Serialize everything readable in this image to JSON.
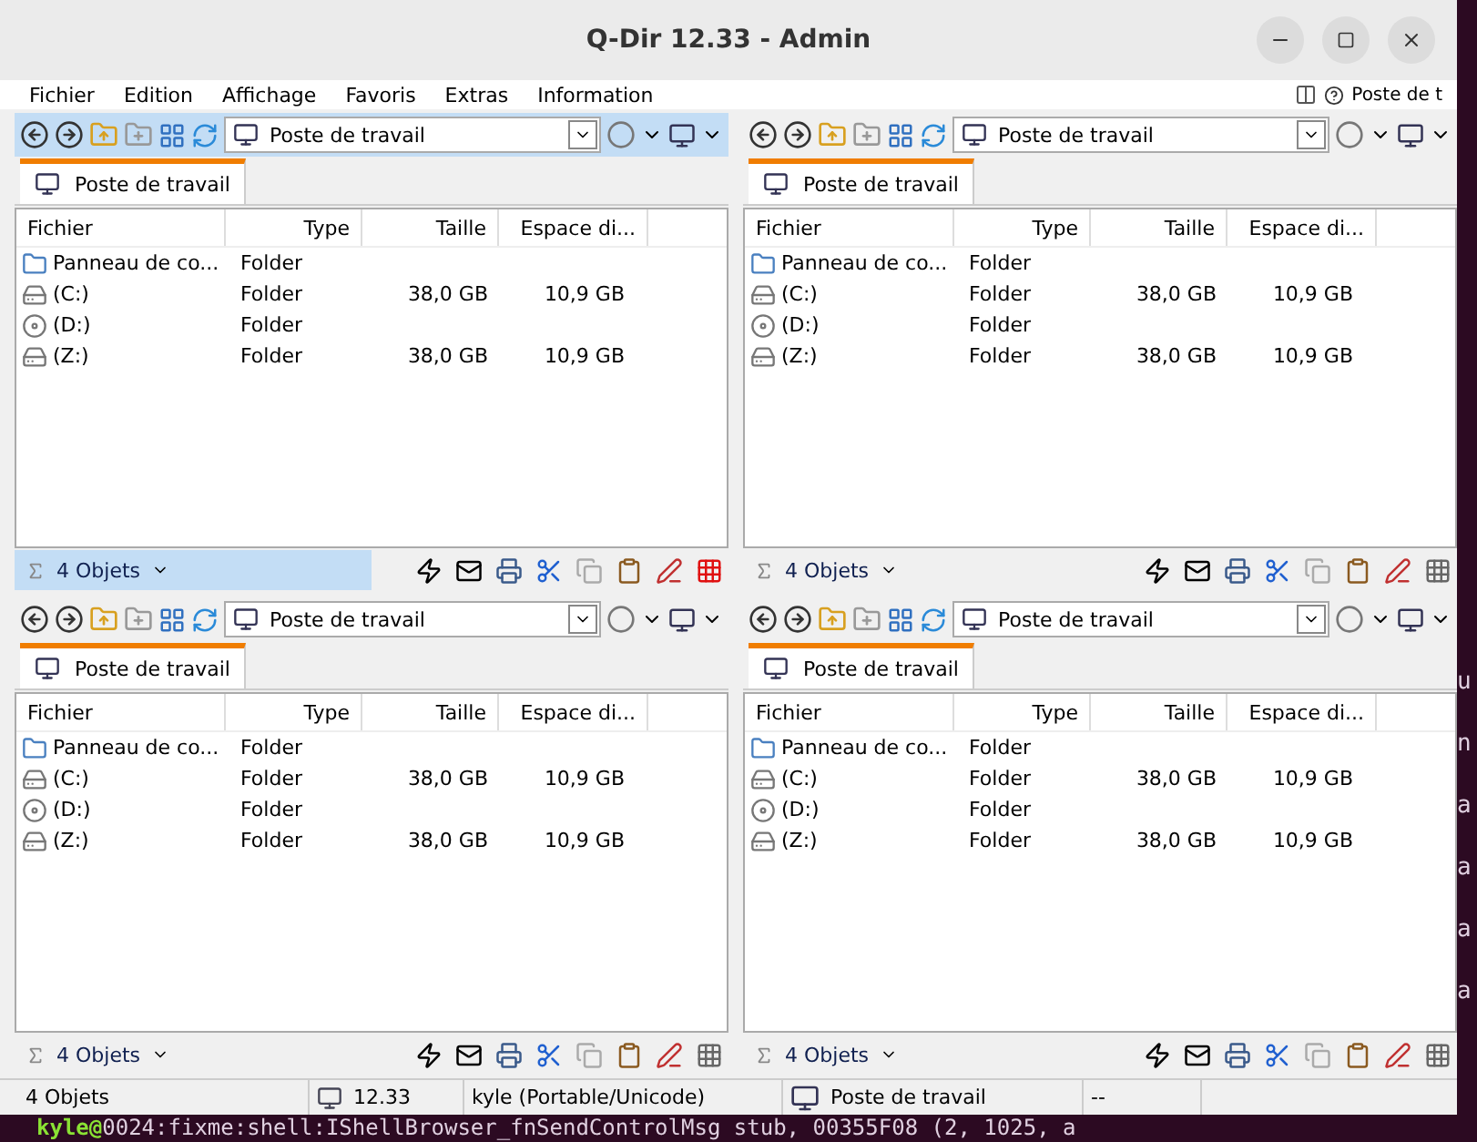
{
  "window": {
    "title": "Q-Dir 12.33 - Admin"
  },
  "menu": [
    "Fichier",
    "Edition",
    "Affichage",
    "Favoris",
    "Extras",
    "Information"
  ],
  "menu_right_label": "Poste de t",
  "panes": [
    {
      "active": true,
      "address": "Poste de travail",
      "tab": "Poste de travail",
      "columns": [
        "Fichier",
        "Type",
        "Taille",
        "Espace di..."
      ],
      "rows": [
        {
          "kind": "folder",
          "name": "Panneau de co...",
          "type": "Folder",
          "size": "",
          "free": ""
        },
        {
          "kind": "drive",
          "name": "(C:)",
          "type": "Folder",
          "size": "38,0 GB",
          "free": "10,9 GB"
        },
        {
          "kind": "cdrom",
          "name": "(D:)",
          "type": "Folder",
          "size": "",
          "free": ""
        },
        {
          "kind": "drive",
          "name": "(Z:)",
          "type": "Folder",
          "size": "38,0 GB",
          "free": "10,9 GB"
        }
      ],
      "status": "4 Objets"
    },
    {
      "active": false,
      "address": "Poste de travail",
      "tab": "Poste de travail",
      "columns": [
        "Fichier",
        "Type",
        "Taille",
        "Espace di..."
      ],
      "rows": [
        {
          "kind": "folder",
          "name": "Panneau de co...",
          "type": "Folder",
          "size": "",
          "free": ""
        },
        {
          "kind": "drive",
          "name": "(C:)",
          "type": "Folder",
          "size": "38,0 GB",
          "free": "10,9 GB"
        },
        {
          "kind": "cdrom",
          "name": "(D:)",
          "type": "Folder",
          "size": "",
          "free": ""
        },
        {
          "kind": "drive",
          "name": "(Z:)",
          "type": "Folder",
          "size": "38,0 GB",
          "free": "10,9 GB"
        }
      ],
      "status": "4 Objets"
    },
    {
      "active": false,
      "address": "Poste de travail",
      "tab": "Poste de travail",
      "columns": [
        "Fichier",
        "Type",
        "Taille",
        "Espace di..."
      ],
      "rows": [
        {
          "kind": "folder",
          "name": "Panneau de co...",
          "type": "Folder",
          "size": "",
          "free": ""
        },
        {
          "kind": "drive",
          "name": "(C:)",
          "type": "Folder",
          "size": "38,0 GB",
          "free": "10,9 GB"
        },
        {
          "kind": "cdrom",
          "name": "(D:)",
          "type": "Folder",
          "size": "",
          "free": ""
        },
        {
          "kind": "drive",
          "name": "(Z:)",
          "type": "Folder",
          "size": "38,0 GB",
          "free": "10,9 GB"
        }
      ],
      "status": "4 Objets"
    },
    {
      "active": false,
      "address": "Poste de travail",
      "tab": "Poste de travail",
      "columns": [
        "Fichier",
        "Type",
        "Taille",
        "Espace di..."
      ],
      "rows": [
        {
          "kind": "folder",
          "name": "Panneau de co...",
          "type": "Folder",
          "size": "",
          "free": ""
        },
        {
          "kind": "drive",
          "name": "(C:)",
          "type": "Folder",
          "size": "38,0 GB",
          "free": "10,9 GB"
        },
        {
          "kind": "cdrom",
          "name": "(D:)",
          "type": "Folder",
          "size": "",
          "free": ""
        },
        {
          "kind": "drive",
          "name": "(Z:)",
          "type": "Folder",
          "size": "38,0 GB",
          "free": "10,9 GB"
        }
      ],
      "status": "4 Objets"
    }
  ],
  "status_bar": {
    "objects": "4 Objets",
    "version": "12.33",
    "user": "kyle (Portable/Unicode)",
    "location": "Poste de travail",
    "extra": "--"
  },
  "terminal": {
    "edge_letters": [
      "u",
      "n",
      "a",
      "a",
      "a",
      "a"
    ],
    "prompt": "kyle@",
    "line": "0024:fixme:shell:IShellBrowser_fnSendControlMsg stub, 00355F08 (2, 1025, a"
  }
}
